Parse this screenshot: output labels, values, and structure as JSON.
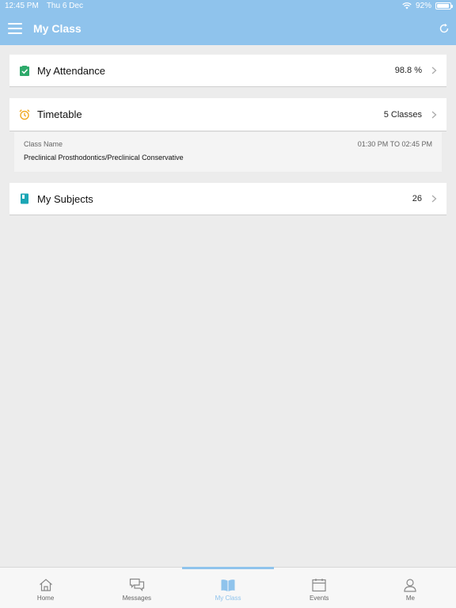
{
  "status_bar": {
    "time": "12:45 PM",
    "date": "Thu 6 Dec",
    "battery": "92%",
    "battery_level": 0.92
  },
  "header": {
    "title": "My Class",
    "menu_icon": "hamburger-icon",
    "refresh_icon": "refresh-icon",
    "color": "#8fc3ec"
  },
  "attendance": {
    "label": "My Attendance",
    "value": "98.8 %",
    "icon": "checkbox-icon",
    "icon_color": "#2eaa6b"
  },
  "timetable": {
    "label": "Timetable",
    "value": "5 Classes",
    "icon": "alarm-clock-icon",
    "icon_color": "#f0a820",
    "entry": {
      "name_label": "Class Name",
      "time": "01:30 PM TO 02:45 PM",
      "class_name": "Preclinical Prosthodontics/Preclinical Conservative"
    }
  },
  "subjects": {
    "label": "My Subjects",
    "value": "26",
    "icon": "book-icon",
    "icon_color": "#1ba6b5"
  },
  "tabs": [
    {
      "label": "Home",
      "icon": "home-icon",
      "active": false
    },
    {
      "label": "Messages",
      "icon": "chat-bubbles-icon",
      "active": false
    },
    {
      "label": "My Class",
      "icon": "open-book-icon",
      "active": true
    },
    {
      "label": "Events",
      "icon": "calendar-icon",
      "active": false
    },
    {
      "label": "Me",
      "icon": "user-icon",
      "active": false
    }
  ]
}
